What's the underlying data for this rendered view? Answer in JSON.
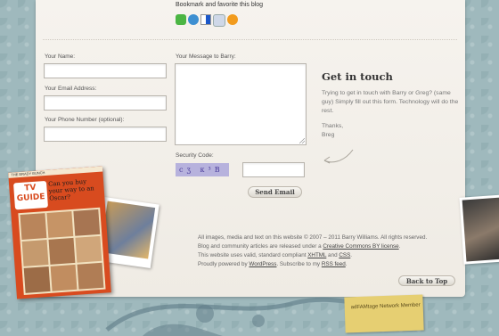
{
  "bookmark": {
    "title": "Bookmark and favorite this blog",
    "icons": [
      {
        "name": "technorati-icon",
        "color": "#4bb543"
      },
      {
        "name": "stumbleupon-icon",
        "color": "#3d8fd1"
      },
      {
        "name": "delicious-icon",
        "color": "#3274d1"
      },
      {
        "name": "digg-icon",
        "color": "#cfd8e8"
      },
      {
        "name": "rss-icon",
        "color": "#f29b1d"
      }
    ]
  },
  "form": {
    "name_label": "Your Name:",
    "email_label": "Your Email Address:",
    "phone_label": "Your Phone Number (optional):",
    "message_label": "Your Message to Barry:",
    "security_label": "Security Code:",
    "captcha_text": "cʒ κ³B",
    "submit_label": "Send Email"
  },
  "get_in_touch": {
    "title": "Get in touch",
    "text": "Trying to get in touch with Barry or Greg? (same guy) Simply fill out this form. Technology will do the rest.",
    "sign1": "Thanks,",
    "sign2": "Breg"
  },
  "footer": {
    "line1": "All images, media and text on this website © 2007 – 2011 Barry Williams. All rights reserved.",
    "line2_pre": "Blog and community articles are released under a ",
    "line2_link": "Creative Commons BY license",
    "line2_post": ".",
    "line3_pre": "This website uses valid, standard compliant ",
    "line3_link1": "XHTML",
    "line3_mid": " and ",
    "line3_link2": "CSS",
    "line3_post": ".",
    "line4_pre": "Proudly powered by ",
    "line4_link1": "WordPress",
    "line4_mid": ". Subscribe to my ",
    "line4_link2": "RSS feed",
    "line4_post": "."
  },
  "back_to_top": "Back to Top",
  "network_note": "adFAMtage Network Member",
  "magazine": {
    "title": "TV GUIDE",
    "headline": "Can you buy your way to an Oscar?",
    "top_text": "THE BRADY BUNCH"
  }
}
